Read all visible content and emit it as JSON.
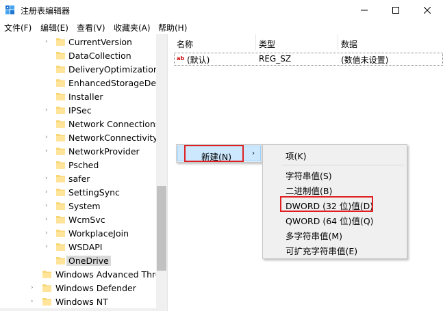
{
  "window": {
    "title": "注册表编辑器",
    "icon": "regedit-icon",
    "controls": [
      "minimize-icon",
      "maximize-icon",
      "close-icon"
    ]
  },
  "menubar": {
    "items": [
      "文件(F)",
      "编辑(E)",
      "查看(V)",
      "收藏夹(A)",
      "帮助(H)"
    ]
  },
  "tree": {
    "items": [
      {
        "label": "CurrentVersion",
        "expandable": true
      },
      {
        "label": "DataCollection",
        "expandable": false
      },
      {
        "label": "DeliveryOptimization",
        "expandable": false
      },
      {
        "label": "EnhancedStorageDevi",
        "expandable": false
      },
      {
        "label": "Installer",
        "expandable": false
      },
      {
        "label": "IPSec",
        "expandable": true
      },
      {
        "label": "Network Connections",
        "expandable": false
      },
      {
        "label": "NetworkConnectivitySt",
        "expandable": true
      },
      {
        "label": "NetworkProvider",
        "expandable": true
      },
      {
        "label": "Psched",
        "expandable": false
      },
      {
        "label": "safer",
        "expandable": true
      },
      {
        "label": "SettingSync",
        "expandable": true
      },
      {
        "label": "System",
        "expandable": true
      },
      {
        "label": "WcmSvc",
        "expandable": true
      },
      {
        "label": "WorkplaceJoin",
        "expandable": true
      },
      {
        "label": "WSDAPI",
        "expandable": true
      },
      {
        "label": "OneDrive",
        "expandable": false,
        "selected": true
      },
      {
        "label": "Windows Advanced Threa",
        "expandable": false
      },
      {
        "label": "Windows Defender",
        "expandable": true
      },
      {
        "label": "Windows NT",
        "expandable": true
      }
    ]
  },
  "list": {
    "columns": [
      "名称",
      "类型",
      "数据"
    ],
    "rows": [
      {
        "name": "(默认)",
        "type": "REG_SZ",
        "data": "(数值未设置)",
        "icon": "string-value-icon"
      }
    ]
  },
  "context_menu": {
    "new_label": "新建(N)",
    "new_arrow": "›",
    "submenu": {
      "key": "项(K)",
      "string": "字符串值(S)",
      "binary": "二进制值(B)",
      "dword": "DWORD (32 位)值(D)",
      "qword": "QWORD (64 位)值(Q)",
      "multi_string": "多字符串值(M)",
      "expandable_string": "可扩充字符串值(E)"
    }
  },
  "colors": {
    "highlight_red": "#e02020",
    "menu_hover": "#cce8ff",
    "folder_yellow": "#f8d775"
  }
}
